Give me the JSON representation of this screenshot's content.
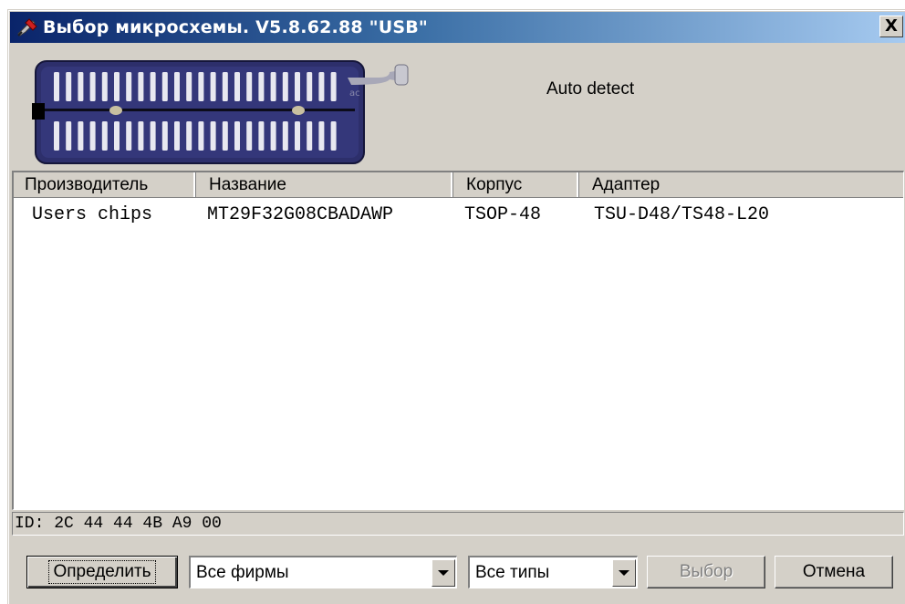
{
  "window": {
    "title": "Выбор микросхемы. V5.8.62.88 \"USB\"",
    "title_icon": "programmer-app-icon",
    "close_label": "X"
  },
  "socket": {
    "image": "zif-socket-illustration",
    "status_text": "Auto detect"
  },
  "list": {
    "columns": [
      "Производитель",
      "Название",
      "Корпус",
      "Адаптер"
    ],
    "rows": [
      [
        "Users chips",
        "MT29F32G08CBADAWP",
        "TSOP-48",
        "TSU-D48/TS48-L20"
      ]
    ]
  },
  "id_line": "ID: 2C 44 44 4B A9 00",
  "controls": {
    "detect_button": "Определить",
    "vendor_combo": "Все фирмы",
    "type_combo": "Все типы",
    "select_button": "Выбор",
    "cancel_button": "Отмена"
  },
  "colors": {
    "face": "#d4d0c8",
    "title_start": "#0a246a",
    "title_end": "#a6caf0",
    "socket_body": "#2d2f6b",
    "disabled_text": "#808080"
  }
}
